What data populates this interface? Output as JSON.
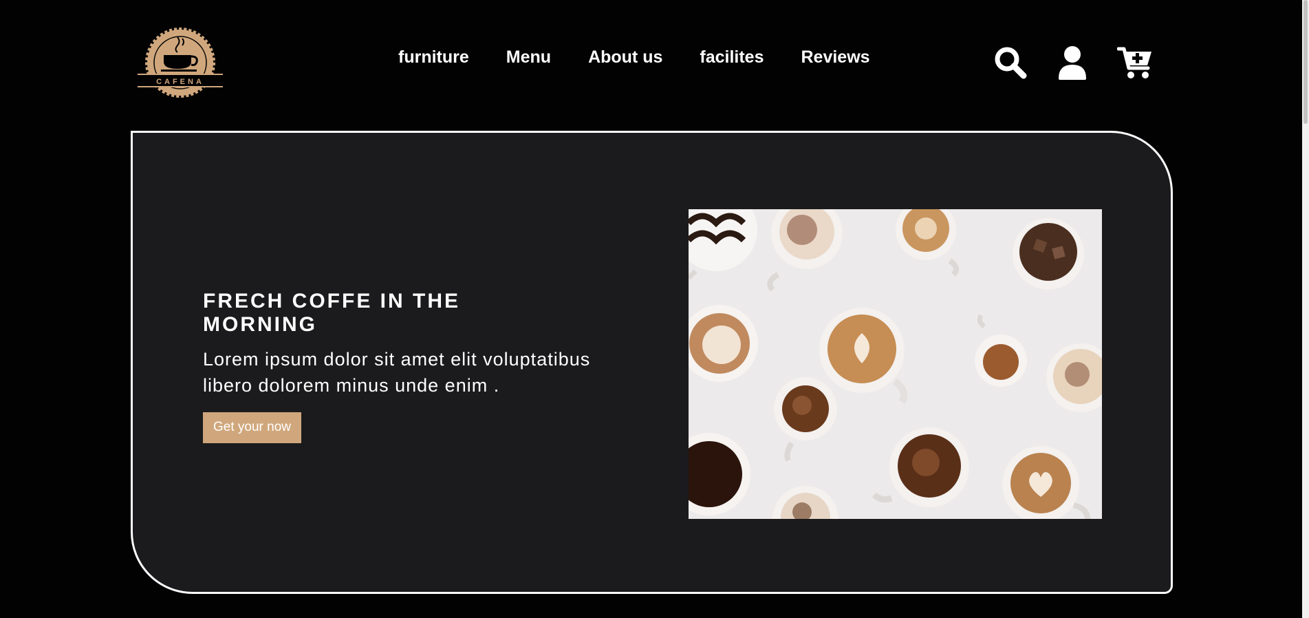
{
  "brand": {
    "logo_text": "CAFENA",
    "accent_color": "#d0a77c"
  },
  "nav": {
    "items": [
      {
        "label": "furniture"
      },
      {
        "label": "Menu"
      },
      {
        "label": "About us"
      },
      {
        "label": "facilites"
      },
      {
        "label": "Reviews"
      }
    ]
  },
  "header_icons": [
    "search-icon",
    "user-icon",
    "cart-plus-icon"
  ],
  "hero": {
    "title": "FRECH COFFE IN THE MORNING",
    "description": "Lorem ipsum dolor sit amet elit voluptatibus libero dolorem minus unde enim .",
    "cta_label": "Get your now"
  },
  "colors": {
    "background": "#020203",
    "panel": "#1b1b1d",
    "accent": "#d0a77c"
  }
}
